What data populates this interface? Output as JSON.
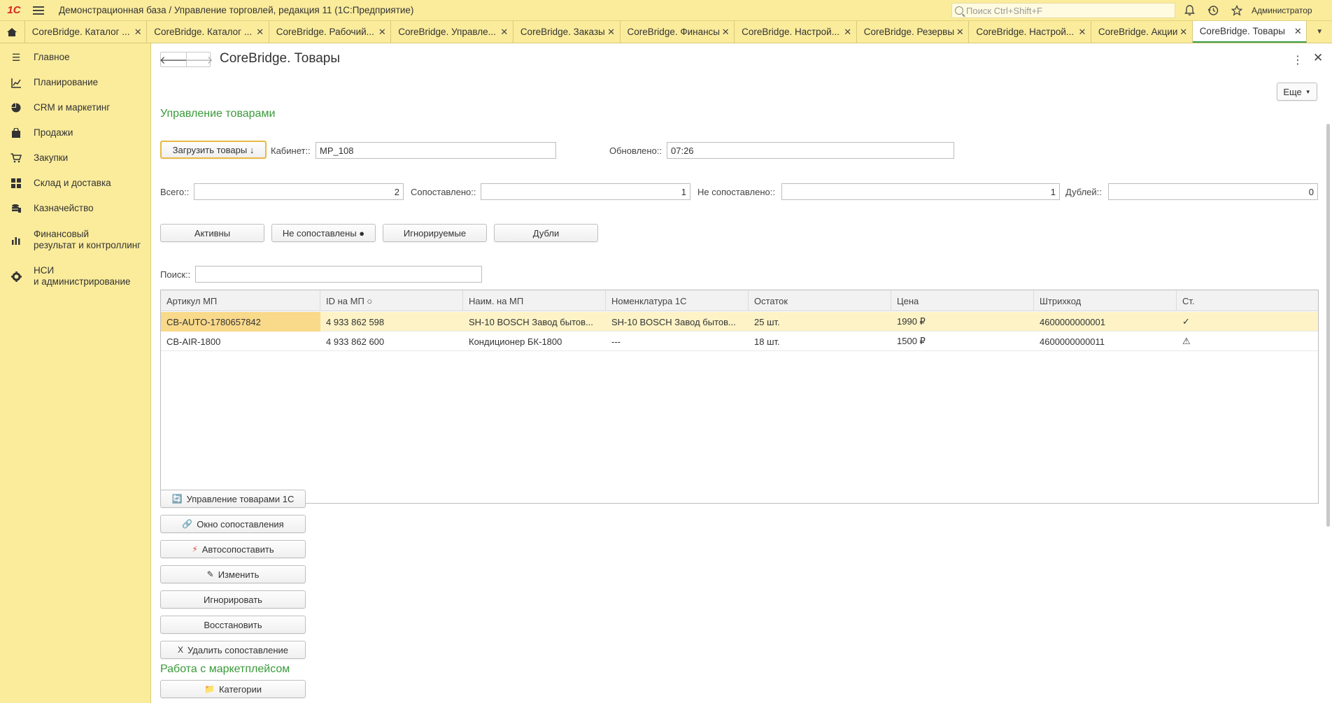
{
  "titlebar": {
    "logo": "1С",
    "app_title": "Демонстрационная база / Управление торговлей, редакция 11  (1С:Предприятие)",
    "search_placeholder": "Поиск Ctrl+Shift+F",
    "user": "Администратор",
    "icons": [
      "bell-icon",
      "history-icon",
      "star-icon"
    ]
  },
  "tabs": [
    {
      "label": "CoreBridge. Каталог ...",
      "active": false
    },
    {
      "label": "CoreBridge. Каталог ...",
      "active": false
    },
    {
      "label": "CoreBridge. Рабочий...",
      "active": false
    },
    {
      "label": "CoreBridge. Управле...",
      "active": false
    },
    {
      "label": "CoreBridge. Заказы",
      "active": false
    },
    {
      "label": "CoreBridge. Финансы",
      "active": false
    },
    {
      "label": "CoreBridge. Настрой...",
      "active": false
    },
    {
      "label": "CoreBridge. Резервы",
      "active": false
    },
    {
      "label": "CoreBridge. Настрой...",
      "active": false
    },
    {
      "label": "CoreBridge. Акции",
      "active": false
    },
    {
      "label": "CoreBridge. Товары",
      "active": true
    }
  ],
  "sidebar": {
    "items": [
      {
        "label": "Главное",
        "icon": "menu-lines-icon"
      },
      {
        "label": "Планирование",
        "icon": "planning-chart-icon"
      },
      {
        "label": "CRM и маркетинг",
        "icon": "pie-chart-icon"
      },
      {
        "label": "Продажи",
        "icon": "shopping-bag-icon"
      },
      {
        "label": "Закупки",
        "icon": "cart-icon"
      },
      {
        "label": "Склад и доставка",
        "icon": "warehouse-grid-icon"
      },
      {
        "label": "Казначейство",
        "icon": "coins-icon"
      },
      {
        "label": "Финансовый\nрезультат и контроллинг",
        "icon": "bar-chart-icon"
      },
      {
        "label": "НСИ\nи администрирование",
        "icon": "gear-icon"
      }
    ]
  },
  "page": {
    "title": "CoreBridge. Товары",
    "more_label": "Еще",
    "section_title": "Управление товарами",
    "load_button": "Загрузить товары ↓",
    "cabinet_label": "Кабинет::",
    "cabinet_value": "MP_108",
    "updated_label": "Обновлено::",
    "updated_value": "07:26",
    "stats": {
      "total_label": "Всего::",
      "total_value": "2",
      "matched_label": "Сопоставлено::",
      "matched_value": "1",
      "unmatched_label": "Не сопоставлено::",
      "unmatched_value": "1",
      "dupes_label": "Дублей::",
      "dupes_value": "0"
    },
    "filters": [
      "Активны",
      "Не сопоставлены ●",
      "Игнорируемые",
      "Дубли"
    ],
    "search_label": "Поиск::",
    "search_value": ""
  },
  "table": {
    "columns": [
      "Артикул МП",
      "ID на МП ○",
      "Наим. на МП",
      "Номенклатура 1С",
      "Остаток",
      "Цена",
      "Штрихкод",
      "Ст."
    ],
    "rows": [
      [
        "CB-AUTO-1780657842",
        "4 933 862 598",
        "SH-10 BOSCH Завод бытов...",
        "SH-10 BOSCH Завод бытов...",
        "25 шт.",
        "1990 ₽",
        "4600000000001",
        "✓"
      ],
      [
        "CB-AIR-1800",
        "4 933 862 600",
        "Кондиционер БК-1800",
        "---",
        "18 шт.",
        "1500 ₽",
        "4600000000011",
        "⚠"
      ]
    ],
    "selected_row": 0
  },
  "actions": [
    {
      "label": "Управление товарами 1С",
      "icon": "🔄"
    },
    {
      "label": "Окно сопоставления",
      "icon": "🔗"
    },
    {
      "label": "Автосопоставить",
      "icon": "⚡"
    },
    {
      "label": "Изменить",
      "icon": "✎"
    },
    {
      "label": "Игнорировать",
      "icon": ""
    },
    {
      "label": "Восстановить",
      "icon": ""
    },
    {
      "label": "Удалить сопоставление",
      "icon": "X"
    }
  ],
  "marketplace": {
    "title": "Работа с маркетплейсом",
    "categories_label": "Категории",
    "categories_icon": "📁"
  },
  "colors": {
    "panel": "#fbec9c",
    "accent_green": "#3a9a3a",
    "selected_row": "#fdf3c6",
    "default_button_border": "#e8b942"
  }
}
